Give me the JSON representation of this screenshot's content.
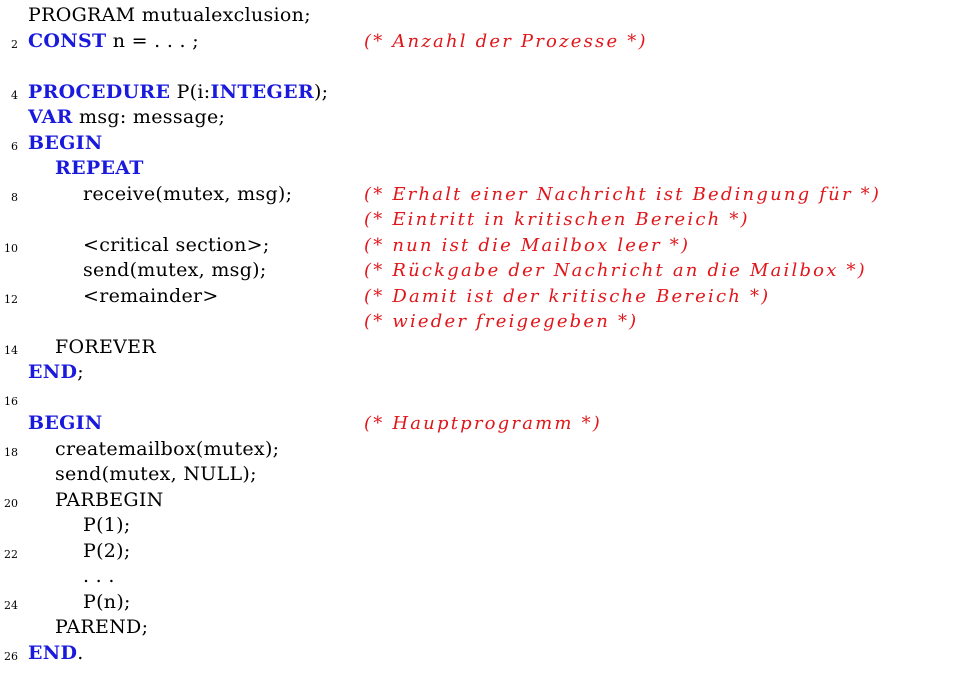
{
  "lines": [
    {
      "n": "",
      "indent": 0,
      "segs": [
        {
          "t": "PROGRAM mutualexclusion;",
          "k": 0
        }
      ],
      "comment": ""
    },
    {
      "n": "2",
      "indent": 0,
      "segs": [
        {
          "t": "CONST",
          "k": 1
        },
        {
          "t": " n = . . . ;",
          "k": 0
        }
      ],
      "comment": "(* Anzahl der Prozesse *)"
    },
    {
      "n": "",
      "indent": 0,
      "segs": [],
      "comment": ""
    },
    {
      "n": "4",
      "indent": 0,
      "segs": [
        {
          "t": "PROCEDURE",
          "k": 1
        },
        {
          "t": " P(i:",
          "k": 0
        },
        {
          "t": "INTEGER",
          "k": 1
        },
        {
          "t": ");",
          "k": 0
        }
      ],
      "comment": ""
    },
    {
      "n": "",
      "indent": 0,
      "segs": [
        {
          "t": "VAR",
          "k": 1
        },
        {
          "t": " msg: message;",
          "k": 0
        }
      ],
      "comment": ""
    },
    {
      "n": "6",
      "indent": 0,
      "segs": [
        {
          "t": "BEGIN",
          "k": 1
        }
      ],
      "comment": ""
    },
    {
      "n": "",
      "indent": 1,
      "segs": [
        {
          "t": "REPEAT",
          "k": 1
        }
      ],
      "comment": ""
    },
    {
      "n": "8",
      "indent": 2,
      "segs": [
        {
          "t": "receive(mutex, msg);",
          "k": 0
        }
      ],
      "comment": "(* Erhalt einer Nachricht ist Bedingung für *)"
    },
    {
      "n": "",
      "indent": 0,
      "segs": [],
      "comment": "(* Eintritt in kritischen Bereich *)"
    },
    {
      "n": "10",
      "indent": 2,
      "segs": [
        {
          "t": "<critical section>;",
          "k": 0
        }
      ],
      "comment": "(* nun ist die Mailbox leer *)"
    },
    {
      "n": "",
      "indent": 2,
      "segs": [
        {
          "t": "send(mutex, msg);",
          "k": 0
        }
      ],
      "comment": "(* Rückgabe der Nachricht an die Mailbox *)"
    },
    {
      "n": "12",
      "indent": 2,
      "segs": [
        {
          "t": "<remainder>",
          "k": 0
        }
      ],
      "comment": "(* Damit ist der kritische Bereich *)"
    },
    {
      "n": "",
      "indent": 0,
      "segs": [],
      "comment": "(* wieder freigegeben *)"
    },
    {
      "n": "14",
      "indent": 1,
      "segs": [
        {
          "t": "FOREVER",
          "k": 0
        }
      ],
      "comment": ""
    },
    {
      "n": "",
      "indent": 0,
      "segs": [
        {
          "t": "END",
          "k": 1
        },
        {
          "t": ";",
          "k": 0
        }
      ],
      "comment": ""
    },
    {
      "n": "16",
      "indent": 0,
      "segs": [],
      "comment": ""
    },
    {
      "n": "",
      "indent": 0,
      "segs": [
        {
          "t": "BEGIN",
          "k": 1
        }
      ],
      "comment": "(* Hauptprogramm *)"
    },
    {
      "n": "18",
      "indent": 1,
      "segs": [
        {
          "t": "createmailbox(mutex);",
          "k": 0
        }
      ],
      "comment": ""
    },
    {
      "n": "",
      "indent": 1,
      "segs": [
        {
          "t": "send(mutex, NULL);",
          "k": 0
        }
      ],
      "comment": ""
    },
    {
      "n": "20",
      "indent": 1,
      "segs": [
        {
          "t": "PARBEGIN",
          "k": 0
        }
      ],
      "comment": ""
    },
    {
      "n": "",
      "indent": 2,
      "segs": [
        {
          "t": "P(1);",
          "k": 0
        }
      ],
      "comment": ""
    },
    {
      "n": "22",
      "indent": 2,
      "segs": [
        {
          "t": "P(2);",
          "k": 0
        }
      ],
      "comment": ""
    },
    {
      "n": "",
      "indent": 2,
      "segs": [
        {
          "t": ". . .",
          "k": 0
        }
      ],
      "comment": ""
    },
    {
      "n": "24",
      "indent": 2,
      "segs": [
        {
          "t": "P(n);",
          "k": 0
        }
      ],
      "comment": ""
    },
    {
      "n": "",
      "indent": 1,
      "segs": [
        {
          "t": "PAREND;",
          "k": 0
        }
      ],
      "comment": ""
    },
    {
      "n": "26",
      "indent": 0,
      "segs": [
        {
          "t": "END",
          "k": 1
        },
        {
          "t": ".",
          "k": 0
        }
      ],
      "comment": ""
    }
  ],
  "colors": {
    "keyword": "#1a1adc",
    "comment": "#e0161b",
    "text": "#000000"
  }
}
